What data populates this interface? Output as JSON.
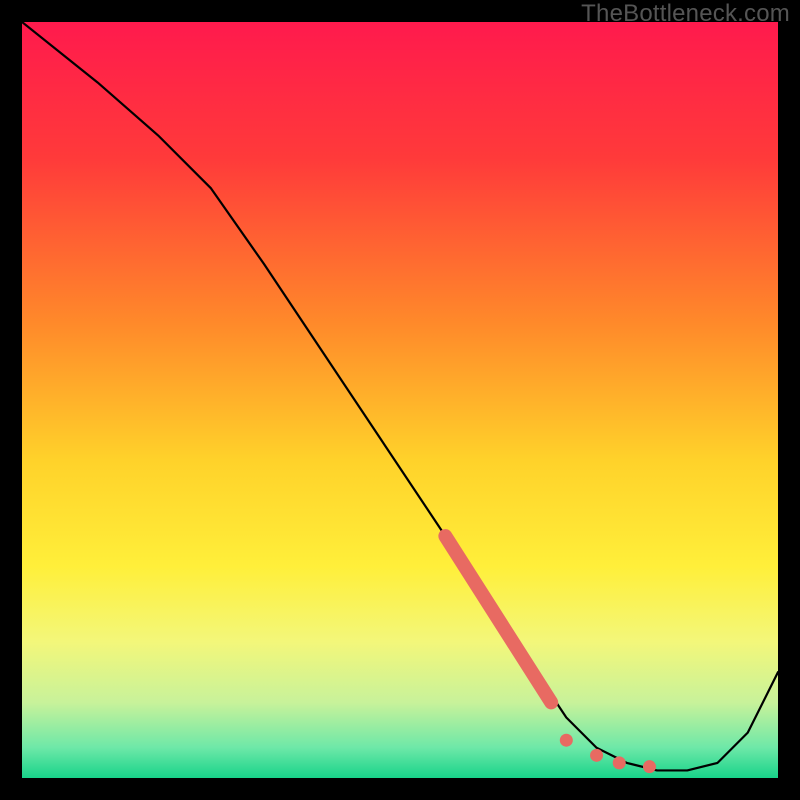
{
  "watermark": "TheBottleneck.com",
  "chart_data": {
    "type": "line",
    "title": "",
    "xlabel": "",
    "ylabel": "",
    "xlim": [
      0,
      100
    ],
    "ylim": [
      0,
      100
    ],
    "grid": false,
    "legend": false,
    "gradient_stops": [
      {
        "offset": 0,
        "color": "#ff1a4d"
      },
      {
        "offset": 18,
        "color": "#ff3a3a"
      },
      {
        "offset": 40,
        "color": "#ff8a2a"
      },
      {
        "offset": 58,
        "color": "#ffd22a"
      },
      {
        "offset": 72,
        "color": "#ffef3a"
      },
      {
        "offset": 82,
        "color": "#f3f77a"
      },
      {
        "offset": 90,
        "color": "#c8f29a"
      },
      {
        "offset": 96,
        "color": "#6de8a8"
      },
      {
        "offset": 100,
        "color": "#18d38a"
      }
    ],
    "series": [
      {
        "name": "bottleneck-curve",
        "color": "#000000",
        "x": [
          0,
          10,
          18,
          25,
          32,
          40,
          48,
          56,
          62,
          68,
          72,
          76,
          80,
          84,
          88,
          92,
          96,
          100
        ],
        "y": [
          100,
          92,
          85,
          78,
          68,
          56,
          44,
          32,
          22,
          14,
          8,
          4,
          2,
          1,
          1,
          2,
          6,
          14
        ]
      }
    ],
    "markers": {
      "name": "highlight-range",
      "color": "#e86a62",
      "thick_segment": {
        "x": [
          56,
          70
        ],
        "y": [
          32,
          10
        ]
      },
      "dots": [
        {
          "x": 72,
          "y": 5
        },
        {
          "x": 76,
          "y": 3
        },
        {
          "x": 79,
          "y": 2
        },
        {
          "x": 83,
          "y": 1.5
        }
      ]
    }
  }
}
